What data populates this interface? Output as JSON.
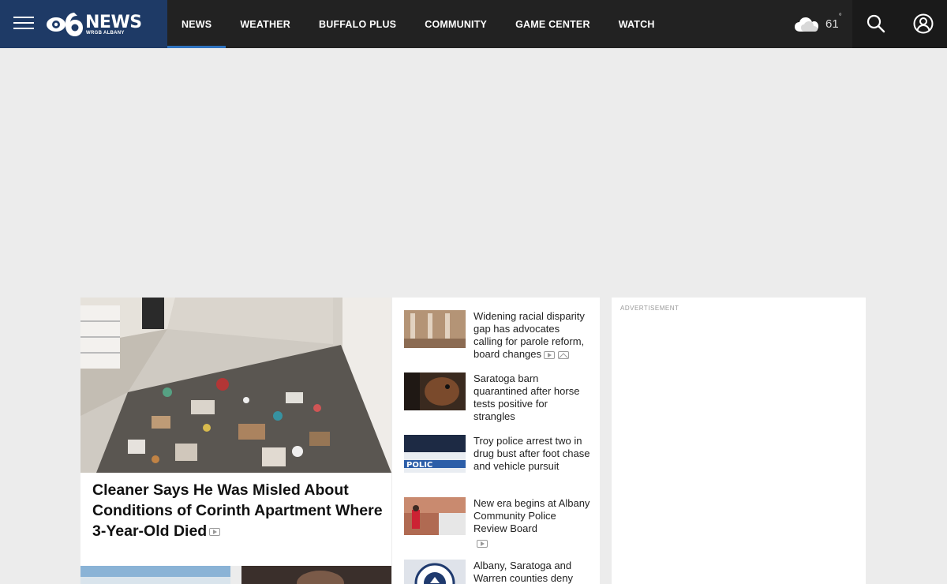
{
  "header": {
    "logo_word": "NEWS",
    "logo_sub": "WRGB ALBANY",
    "nav": [
      {
        "label": "NEWS",
        "active": true
      },
      {
        "label": "WEATHER"
      },
      {
        "label": "BUFFALO PLUS"
      },
      {
        "label": "COMMUNITY"
      },
      {
        "label": "GAME CENTER"
      },
      {
        "label": "WATCH"
      }
    ],
    "weather": {
      "temp": "61",
      "degree": "°",
      "icon": "cloud-icon"
    },
    "icons": {
      "menu": "hamburger-menu-icon",
      "search": "search-icon",
      "account": "user-account-icon"
    }
  },
  "feature": {
    "title": "Cleaner Says He Was Misled About Conditions of Corinth Apartment Where 3-Year-Old Died",
    "has_video": true
  },
  "stories": [
    {
      "title": "Widening racial disparity gap has advocates calling for parole reform, board changes",
      "video": true,
      "gallery": true
    },
    {
      "title": "Saratoga barn quarantined after horse tests positive for strangles"
    },
    {
      "title": "Troy police arrest two in drug bust after foot chase and vehicle pursuit"
    },
    {
      "title": "New era begins at Albany Community Police Review Board",
      "video": true
    },
    {
      "title": "Albany, Saratoga and Warren counties deny"
    }
  ],
  "ad": {
    "label": "ADVERTISEMENT"
  },
  "colors": {
    "header_bg": "#222222",
    "logo_bg": "#1e3a66",
    "nav_active": "#2f73c0",
    "page_bg": "#ececec"
  }
}
